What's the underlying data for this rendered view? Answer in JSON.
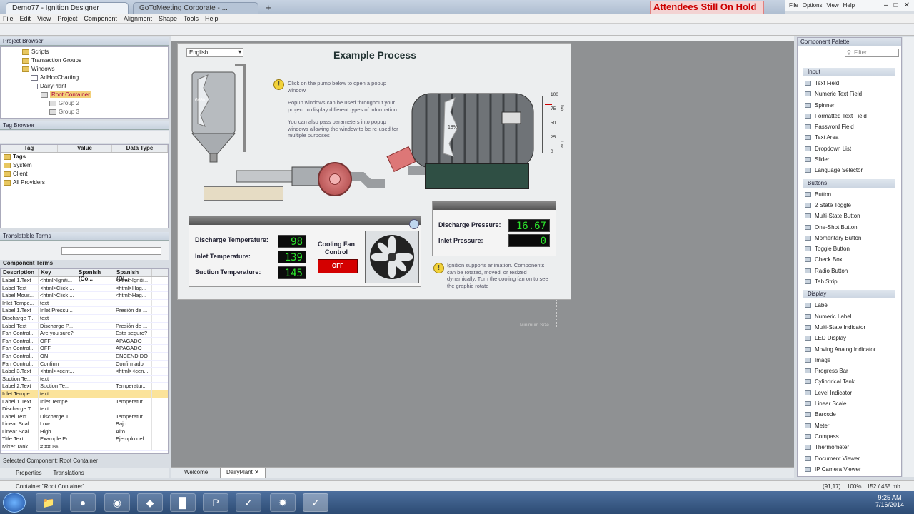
{
  "browser": {
    "tabs": [
      "Demo77 - Ignition Designer",
      "GoToMeeting Corporate - ..."
    ],
    "new_tab": "+",
    "banner": "Attendees Still On Hold",
    "menu": [
      "File",
      "Options",
      "View",
      "Help"
    ]
  },
  "app_menu": [
    "File",
    "Edit",
    "View",
    "Project",
    "Component",
    "Alignment",
    "Shape",
    "Tools",
    "Help"
  ],
  "project_browser": {
    "title": "Project Browser",
    "items": [
      "Scripts",
      "Transaction Groups",
      "Windows",
      "AdHocCharting",
      "DairyPlant",
      "Root Container",
      "Group 2",
      "Group 3"
    ]
  },
  "tag_browser": {
    "title": "Tag Browser",
    "columns": [
      "Tag",
      "Value",
      "Data Type"
    ],
    "items": [
      "Tags",
      "System",
      "Client",
      "All Providers"
    ]
  },
  "translatable": {
    "title": "Translatable Terms",
    "section": "Component Terms",
    "columns": [
      "Description",
      "Key",
      "Spanish (Co...",
      "Spanish (Gl..."
    ],
    "rows": [
      [
        "Label 1.Text",
        "<html>Igniti...",
        "",
        "<html>Igniti..."
      ],
      [
        "Label.Text",
        "<html>Click ...",
        "",
        "<html>Hag..."
      ],
      [
        "Label.Mous...",
        "<html>Click ...",
        "",
        "<html>Hag..."
      ],
      [
        "Inlet Tempe...",
        "text",
        "",
        ""
      ],
      [
        "Label 1.Text",
        "Inlet Pressu...",
        "",
        "Presión de ..."
      ],
      [
        "Discharge T...",
        "text",
        "",
        ""
      ],
      [
        "Label.Text",
        "Discharge P...",
        "",
        "Presión de ..."
      ],
      [
        "Fan Control...",
        "Are you sure?",
        "",
        "Esta seguro?"
      ],
      [
        "Fan Control...",
        "OFF",
        "",
        "APAGADO"
      ],
      [
        "Fan Control...",
        "OFF",
        "",
        "APAGADO"
      ],
      [
        "Fan Control...",
        "ON",
        "",
        "ENCENDIDO"
      ],
      [
        "Fan Control...",
        "Confirm",
        "",
        "Confirmado"
      ],
      [
        "Label 3.Text",
        "<html><cent...",
        "",
        "<html><cen..."
      ],
      [
        "Suction Te...",
        "text",
        "",
        ""
      ],
      [
        "Label 2.Text",
        "Suction Te...",
        "",
        "Temperatur..."
      ],
      [
        "Inlet Tempe...",
        "text",
        "",
        ""
      ],
      [
        "Label 1.Text",
        "Inlet Tempe...",
        "",
        "Temperatur..."
      ],
      [
        "Discharge T...",
        "text",
        "",
        ""
      ],
      [
        "Label.Text",
        "Discharge T...",
        "",
        "Temperatur..."
      ],
      [
        "Linear Scal...",
        "Low",
        "",
        "Bajo"
      ],
      [
        "Linear Scal...",
        "High",
        "",
        "Alto"
      ],
      [
        "Title.Text",
        "Example Pr...",
        "",
        "Ejemplo del..."
      ],
      [
        "Mixer Tank...",
        "#,##0%",
        "",
        ""
      ]
    ],
    "selected_row": 15
  },
  "selected_component": "Selected Component: Root Container",
  "left_tabs": [
    "Properties",
    "Translations"
  ],
  "window": {
    "language": "English",
    "title": "Example Process",
    "popup_info": [
      "Click on the pump below to open a popup window.",
      "Popup windows can be used throughout your project to display different types of information.",
      "You can also pass parameters into popup windows allowing the window to be re-used for multiple purposes"
    ],
    "tank1_level": "66%",
    "tank2_level": "18%",
    "scale": {
      "values": [
        "100",
        "75",
        "50",
        "25",
        "0"
      ],
      "high": "High",
      "low": "Low"
    },
    "temps": [
      {
        "label": "Discharge Temperature:",
        "value": "98"
      },
      {
        "label": "Inlet Temperature:",
        "value": "139"
      },
      {
        "label": "Suction Temperature:",
        "value": "145"
      }
    ],
    "fan_label": "Cooling Fan Control",
    "fan_button": "OFF",
    "pressures": [
      {
        "label": "Discharge Pressure:",
        "value": "16.67"
      },
      {
        "label": "Inlet Pressure:",
        "value": "0"
      }
    ],
    "anim_info": "Ignition supports animation. Components can be rotated, moved, or resized dynamically. Turn the cooling fan on to see the graphic rotate",
    "min_size": "Minimum Size"
  },
  "palette": {
    "title": "Component Palette",
    "filter": "Filter",
    "groups": [
      {
        "name": "Input",
        "items": [
          "Text Field",
          "Numeric Text Field",
          "Spinner",
          "Formatted Text Field",
          "Password Field",
          "Text Area",
          "Dropdown List",
          "Slider",
          "Language Selector"
        ]
      },
      {
        "name": "Buttons",
        "items": [
          "Button",
          "2 State Toggle",
          "Multi-State Button",
          "One-Shot Button",
          "Momentary Button",
          "Toggle Button",
          "Check Box",
          "Radio Button",
          "Tab Strip"
        ]
      },
      {
        "name": "Display",
        "items": [
          "Label",
          "Numeric Label",
          "Multi-State Indicator",
          "LED Display",
          "Moving Analog Indicator",
          "Image",
          "Progress Bar",
          "Cylindrical Tank",
          "Level Indicator",
          "Linear Scale",
          "Barcode",
          "Meter",
          "Compass",
          "Thermometer",
          "Document Viewer",
          "IP Camera Viewer"
        ]
      }
    ]
  },
  "bottom_tabs": [
    "Welcome",
    "DairyPlant"
  ],
  "status": {
    "left": "Container \"Root Container\"",
    "coords": "(91,17)",
    "zoom": "100%",
    "memory": "152 / 455 mb"
  },
  "clock": {
    "time": "9:25 AM",
    "date": "7/16/2014"
  }
}
